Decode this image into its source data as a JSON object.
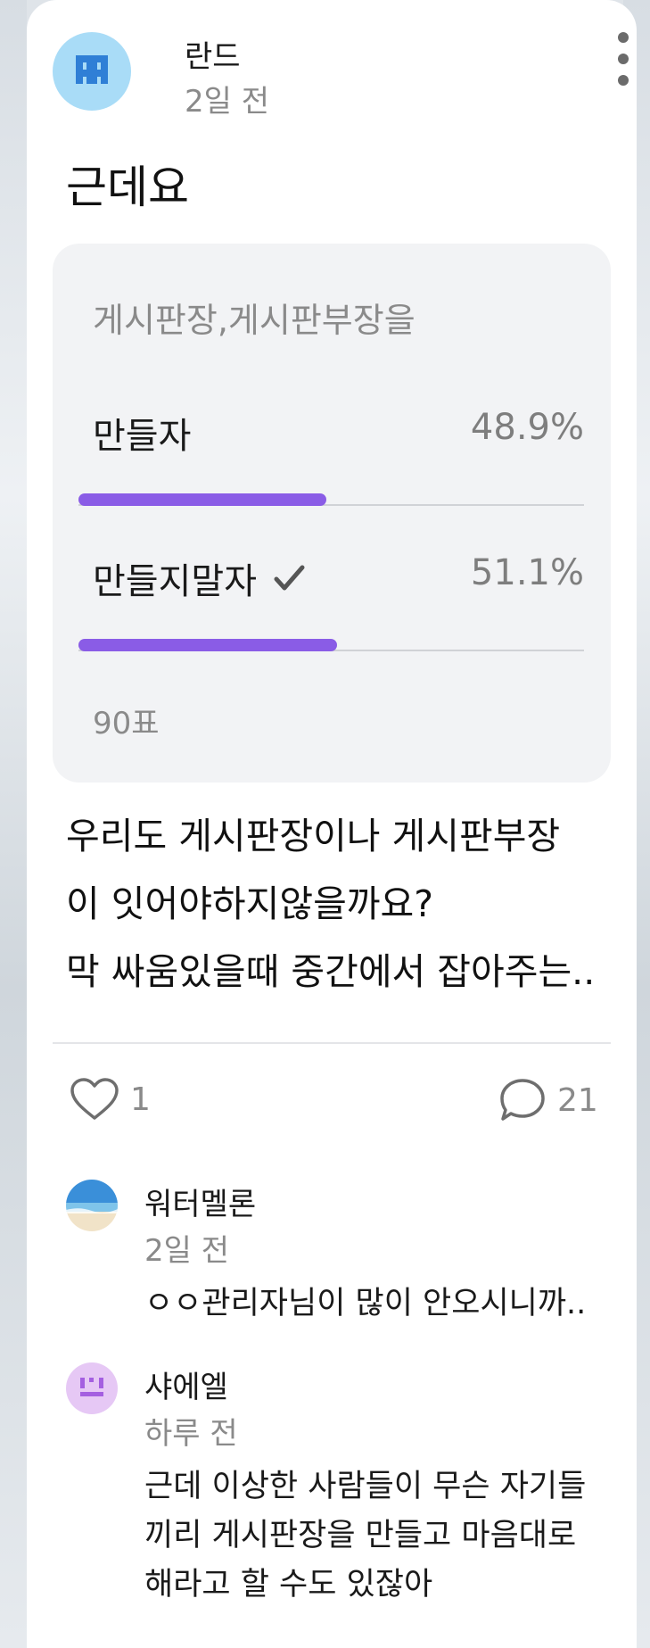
{
  "post": {
    "author": "란드",
    "time": "2일 전",
    "title": "근데요",
    "body_lines": [
      "우리도 게시판장이나 게시판부장",
      "이 잇어야하지않을까요?",
      "막 싸움있을때 중간에서 잡아주는.."
    ]
  },
  "poll": {
    "question": "게시판장,게시판부장을",
    "options": [
      {
        "label": "만들자",
        "percent": "48.9%",
        "fill_fraction": 0.489,
        "selected": false
      },
      {
        "label": "만들지말자",
        "percent": "51.1%",
        "fill_fraction": 0.511,
        "selected": true
      }
    ],
    "vote_count": "90표",
    "accent": "#8a5ce6"
  },
  "stats": {
    "likes": "1",
    "comments": "21"
  },
  "comments": [
    {
      "author": "워터멜론",
      "time": "2일 전",
      "lines": [
        "ㅇㅇ관리자님이 많이 안오시니까.."
      ],
      "avatar": "beach-avatar"
    },
    {
      "author": "샤에엘",
      "time": "하루 전",
      "lines": [
        "근데 이상한 사람들이 무슨 자기들",
        "끼리 게시판장을 만들고 마음대로",
        "해라고 할 수도 있잖아"
      ],
      "avatar": "pixel-avatar"
    }
  ],
  "icons": {
    "more": "more-vertical-icon",
    "check": "check-icon",
    "like": "heart-icon",
    "comment": "speech-bubble-icon"
  }
}
